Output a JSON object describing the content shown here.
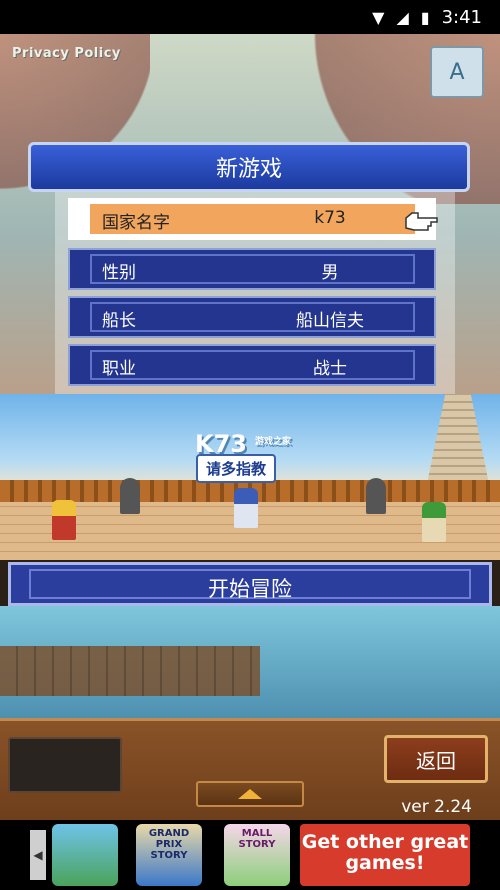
{
  "statusbar": {
    "time": "3:41"
  },
  "privacy_label": "Privacy Policy",
  "lang_button": {
    "label": "A"
  },
  "dialog": {
    "title": "新游戏",
    "rows": [
      {
        "label": "国家名字",
        "value": "k73"
      },
      {
        "label": "性别",
        "value": "男"
      },
      {
        "label": "船长",
        "value": "船山信夫"
      },
      {
        "label": "职业",
        "value": "战士"
      }
    ]
  },
  "scene": {
    "speech": "请多指教",
    "watermark": "K73",
    "watermark_sub": "游戏之家"
  },
  "start_button": "开始冒险",
  "back_button": "返回",
  "version": "ver 2.24",
  "ad": {
    "games": [
      "",
      "GRAND PRIX STORY",
      "MALL STORY"
    ],
    "promo": "Get other great games!"
  }
}
